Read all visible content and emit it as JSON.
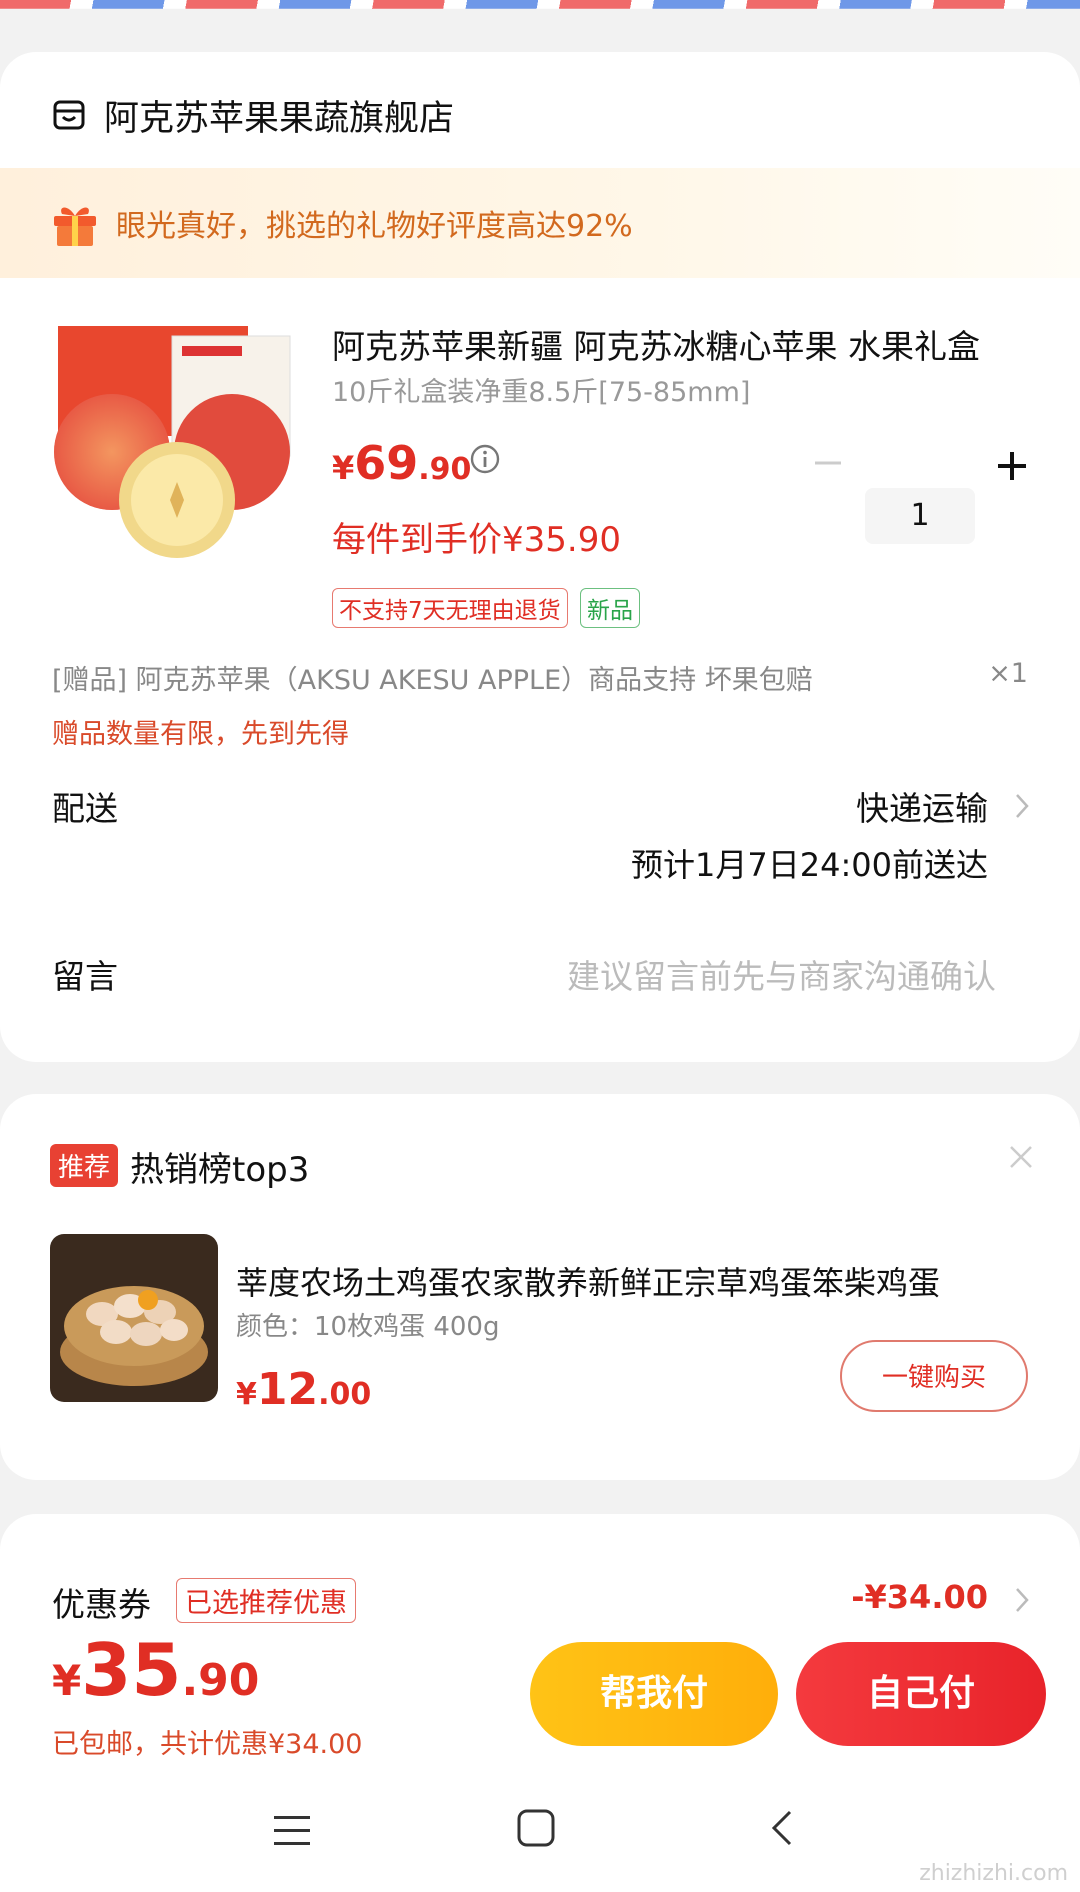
{
  "store": {
    "name": "阿克苏苹果果蔬旗舰店",
    "gift_banner": "眼光真好，挑选的礼物好评度高达92%"
  },
  "product": {
    "title": "阿克苏苹果新疆 阿克苏冰糖心苹果 水果礼盒",
    "spec": "10斤礼盒装净重8.5斤[75-85mm]",
    "price_yen": "¥",
    "price_int": "69",
    "price_dec": ".90",
    "quantity": "1",
    "final_price": "每件到手价¥35.90",
    "tag_noreturn": "不支持7天无理由退货",
    "tag_new": "新品",
    "gift_line": "[赠品]  阿克苏苹果（AKSU AKESU APPLE）商品支持 坏果包赔",
    "gift_count": "×1",
    "gift_limit": "赠品数量有限，先到先得"
  },
  "delivery": {
    "label": "配送",
    "method": "快递运输",
    "eta": "预计1月7日24:00前送达"
  },
  "message": {
    "label": "留言",
    "placeholder": "建议留言前先与商家沟通确认"
  },
  "recommend": {
    "tag": "推荐",
    "title": "热销榜top3",
    "item_name": "莘度农场土鸡蛋农家散养新鲜正宗草鸡蛋笨柴鸡蛋",
    "item_spec": "颜色：10枚鸡蛋 400g",
    "price_yen": "¥",
    "price_int": "12",
    "price_dec": ".00",
    "buy_label": "一键购买"
  },
  "payment": {
    "coupon_label": "优惠券",
    "coupon_tag": "已选推荐优惠",
    "coupon_amount": "-¥34.00",
    "total_yen": "¥",
    "total_int": "35",
    "total_dec": ".90",
    "total_sub": "已包邮，共计优惠¥34.00",
    "help_pay": "帮我付",
    "self_pay": "自己付"
  },
  "watermark": "zhizhizhi.com",
  "colors": {
    "accent_red": "#e02e24",
    "help_button": "#ffb80e",
    "self_button": "#ee2e33",
    "tag_green": "#2aa44a"
  }
}
